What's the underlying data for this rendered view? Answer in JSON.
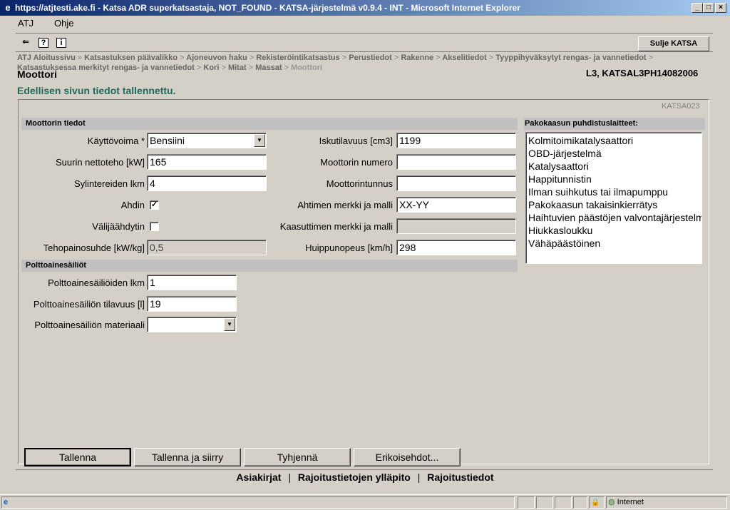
{
  "window": {
    "title": "https://atjtesti.ake.fi - Katsa ADR superkatsastaja, NOT_FOUND - KATSA-järjestelmä v0.9.4 - INT - Microsoft Internet Explorer",
    "minimize": "_",
    "restore": "□",
    "close": "×"
  },
  "menu": {
    "atj": "ATJ",
    "ohje": "Ohje"
  },
  "toolbar": {
    "back_icon": "⇐",
    "help_icon": "?",
    "info_icon": "i",
    "close_label": "Sulje KATSA"
  },
  "breadcrumb": {
    "items": [
      "ATJ Aloitussivu",
      "Katsastuksen päävalikko",
      "Ajoneuvon haku",
      "Rekisteröintikatsastus",
      "Perustiedot",
      "Rakenne",
      "Akselitiedot",
      "Tyyppihyväksytyt rengas- ja vannetiedot",
      "Katsastuksessa merkityt rengas- ja vannetiedot",
      "Kori",
      "Mitat",
      "Massat",
      "Moottori"
    ],
    "sep_raquo": "»",
    "sep_gt": ">"
  },
  "page": {
    "title": "Moottori",
    "id": "L3, KATSAL3PH14082006",
    "message": "Edellisen sivun tiedot tallennettu.",
    "code": "KATSA023"
  },
  "engine": {
    "header": "Moottorin tiedot",
    "kayttovoima_label": "Käyttövoima *",
    "kayttovoima_value": "Bensiini",
    "nettoteho_label": "Suurin nettoteho [kW]",
    "nettoteho_value": "165",
    "sylinterit_label": "Sylintereiden lkm",
    "sylinterit_value": "4",
    "ahdin_label": "Ahdin",
    "ahdin_checked": "✓",
    "valijaahdytin_label": "Välijäähdytin",
    "tehopaino_label": "Tehopainosuhde [kW/kg]",
    "tehopaino_value": "0,5",
    "iskutilavuus_label": "Iskutilavuus [cm3]",
    "iskutilavuus_value": "1199",
    "moottorinumero_label": "Moottorin numero",
    "moottorinumero_value": "",
    "moottoritunnus_label": "Moottorintunnus",
    "moottoritunnus_value": "",
    "ahtimen_label": "Ahtimen merkki ja malli",
    "ahtimen_value": "XX-YY",
    "kaasuttimen_label": "Kaasuttimen merkki ja malli",
    "kaasuttimen_value": "",
    "huippunopeus_label": "Huippunopeus [km/h]",
    "huippunopeus_value": "298"
  },
  "fuel": {
    "header": "Polttoainesäiliöt",
    "lkm_label": "Polttoainesäiliöiden lkm",
    "lkm_value": "1",
    "tilavuus_label": "Polttoainesäiliön tilavuus [l]",
    "tilavuus_value": "19",
    "materiaali_label": "Polttoainesäiliön materiaali",
    "materiaali_value": ""
  },
  "exhaust": {
    "header": "Pakokaasun puhdistuslaitteet:",
    "options": [
      "Kolmitoimikatalysaattori",
      "OBD-järjestelmä",
      "Katalysaattori",
      "Happitunnistin",
      "Ilman suihkutus tai ilmapumppu",
      "Pakokaasun takaisinkierrätys",
      "Haihtuvien päästöjen valvontajärjestelmä",
      "Hiukkasloukku",
      "Vähäpäästöinen"
    ]
  },
  "buttons": {
    "tallenna": "Tallenna",
    "tallenna_siirry": "Tallenna ja siirry",
    "tyhjenna": "Tyhjennä",
    "erikoisehdot": "Erikoisehdot..."
  },
  "footer": {
    "asiakirjat": "Asiakirjat",
    "rajoitus_yllapito": "Rajoitustietojen ylläpito",
    "rajoitustiedot": "Rajoitustiedot",
    "sep": "|"
  },
  "status": {
    "zone": "Internet",
    "lock_icon": "🔒",
    "globe_icon": "◍",
    "page_icon": "e"
  },
  "colors": {
    "title_start": "#0a246a",
    "title_end": "#a6caf0",
    "message": "#1e6b5a",
    "chrome": "#d4d0c8"
  }
}
